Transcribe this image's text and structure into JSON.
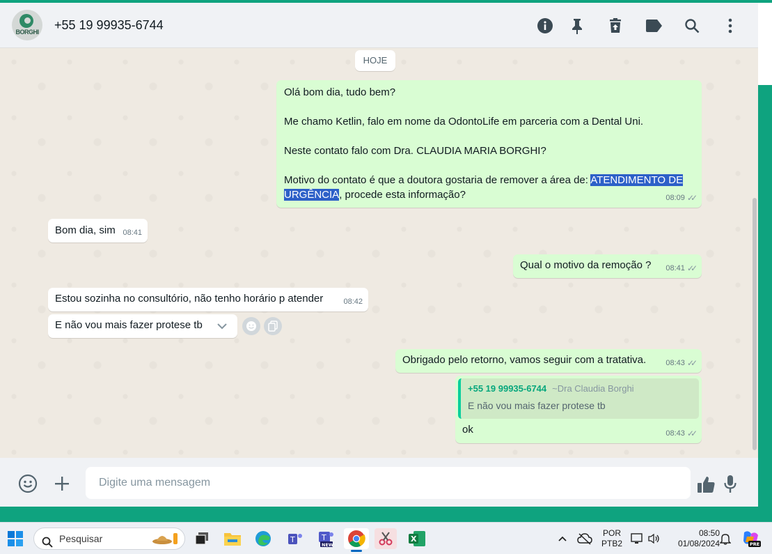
{
  "header": {
    "avatar_text": "BORGHI",
    "contact_name": "+55 19 99935-6744",
    "icons": [
      "info-icon",
      "pin-icon",
      "delete-icon",
      "label-icon",
      "search-icon",
      "menu-icon"
    ]
  },
  "chat": {
    "day_label": "HOJE",
    "messages": [
      {
        "from": "me",
        "p1": "Olá bom dia, tudo bem?",
        "p2": "Me chamo Ketlin, falo em nome da OdontoLife em parceria com a Dental Uni.",
        "p3": "Neste contato falo com Dra. CLAUDIA MARIA BORGHI?",
        "p4a": "Motivo do contato é que a doutora gostaria de remover a área de: ",
        "p4hl1": "ATENDIMENTO DE ",
        "p4hl2": "URGÊNCIA",
        "p4b": ", procede esta informação?",
        "time": "08:09"
      },
      {
        "from": "them",
        "text": "Bom dia, sim",
        "time": "08:41"
      },
      {
        "from": "me",
        "text": "Qual o motivo da remoção ?",
        "time": "08:41"
      },
      {
        "from": "them",
        "text": "Estou sozinha no consultório,  não tenho horário p atender",
        "time": "08:42"
      },
      {
        "from": "them",
        "text": "E não vou mais fazer protese tb"
      },
      {
        "from": "me",
        "text": "Obrigado pelo retorno, vamos seguir com a tratativa.",
        "time": "08:43"
      },
      {
        "from": "me",
        "quote_author": "+55 19 99935-6744",
        "quote_alias": "~Dra Claudia Borghi",
        "quote_text": "E não vou mais fazer protese tb",
        "text": "ok",
        "time": "08:43"
      }
    ]
  },
  "composer": {
    "placeholder": "Digite uma mensagem"
  },
  "taskbar": {
    "search_label": "Pesquisar",
    "lang_top": "POR",
    "lang_bottom": "PTB2",
    "clock_time": "08:50",
    "clock_date": "01/08/2024",
    "copilot_badge": "PRE",
    "teams_badge": "NEW"
  },
  "colors": {
    "outgoing": "#d9fdd3",
    "incoming": "#ffffff",
    "accent": "#0fa37f",
    "highlight": "#2d60c8"
  }
}
